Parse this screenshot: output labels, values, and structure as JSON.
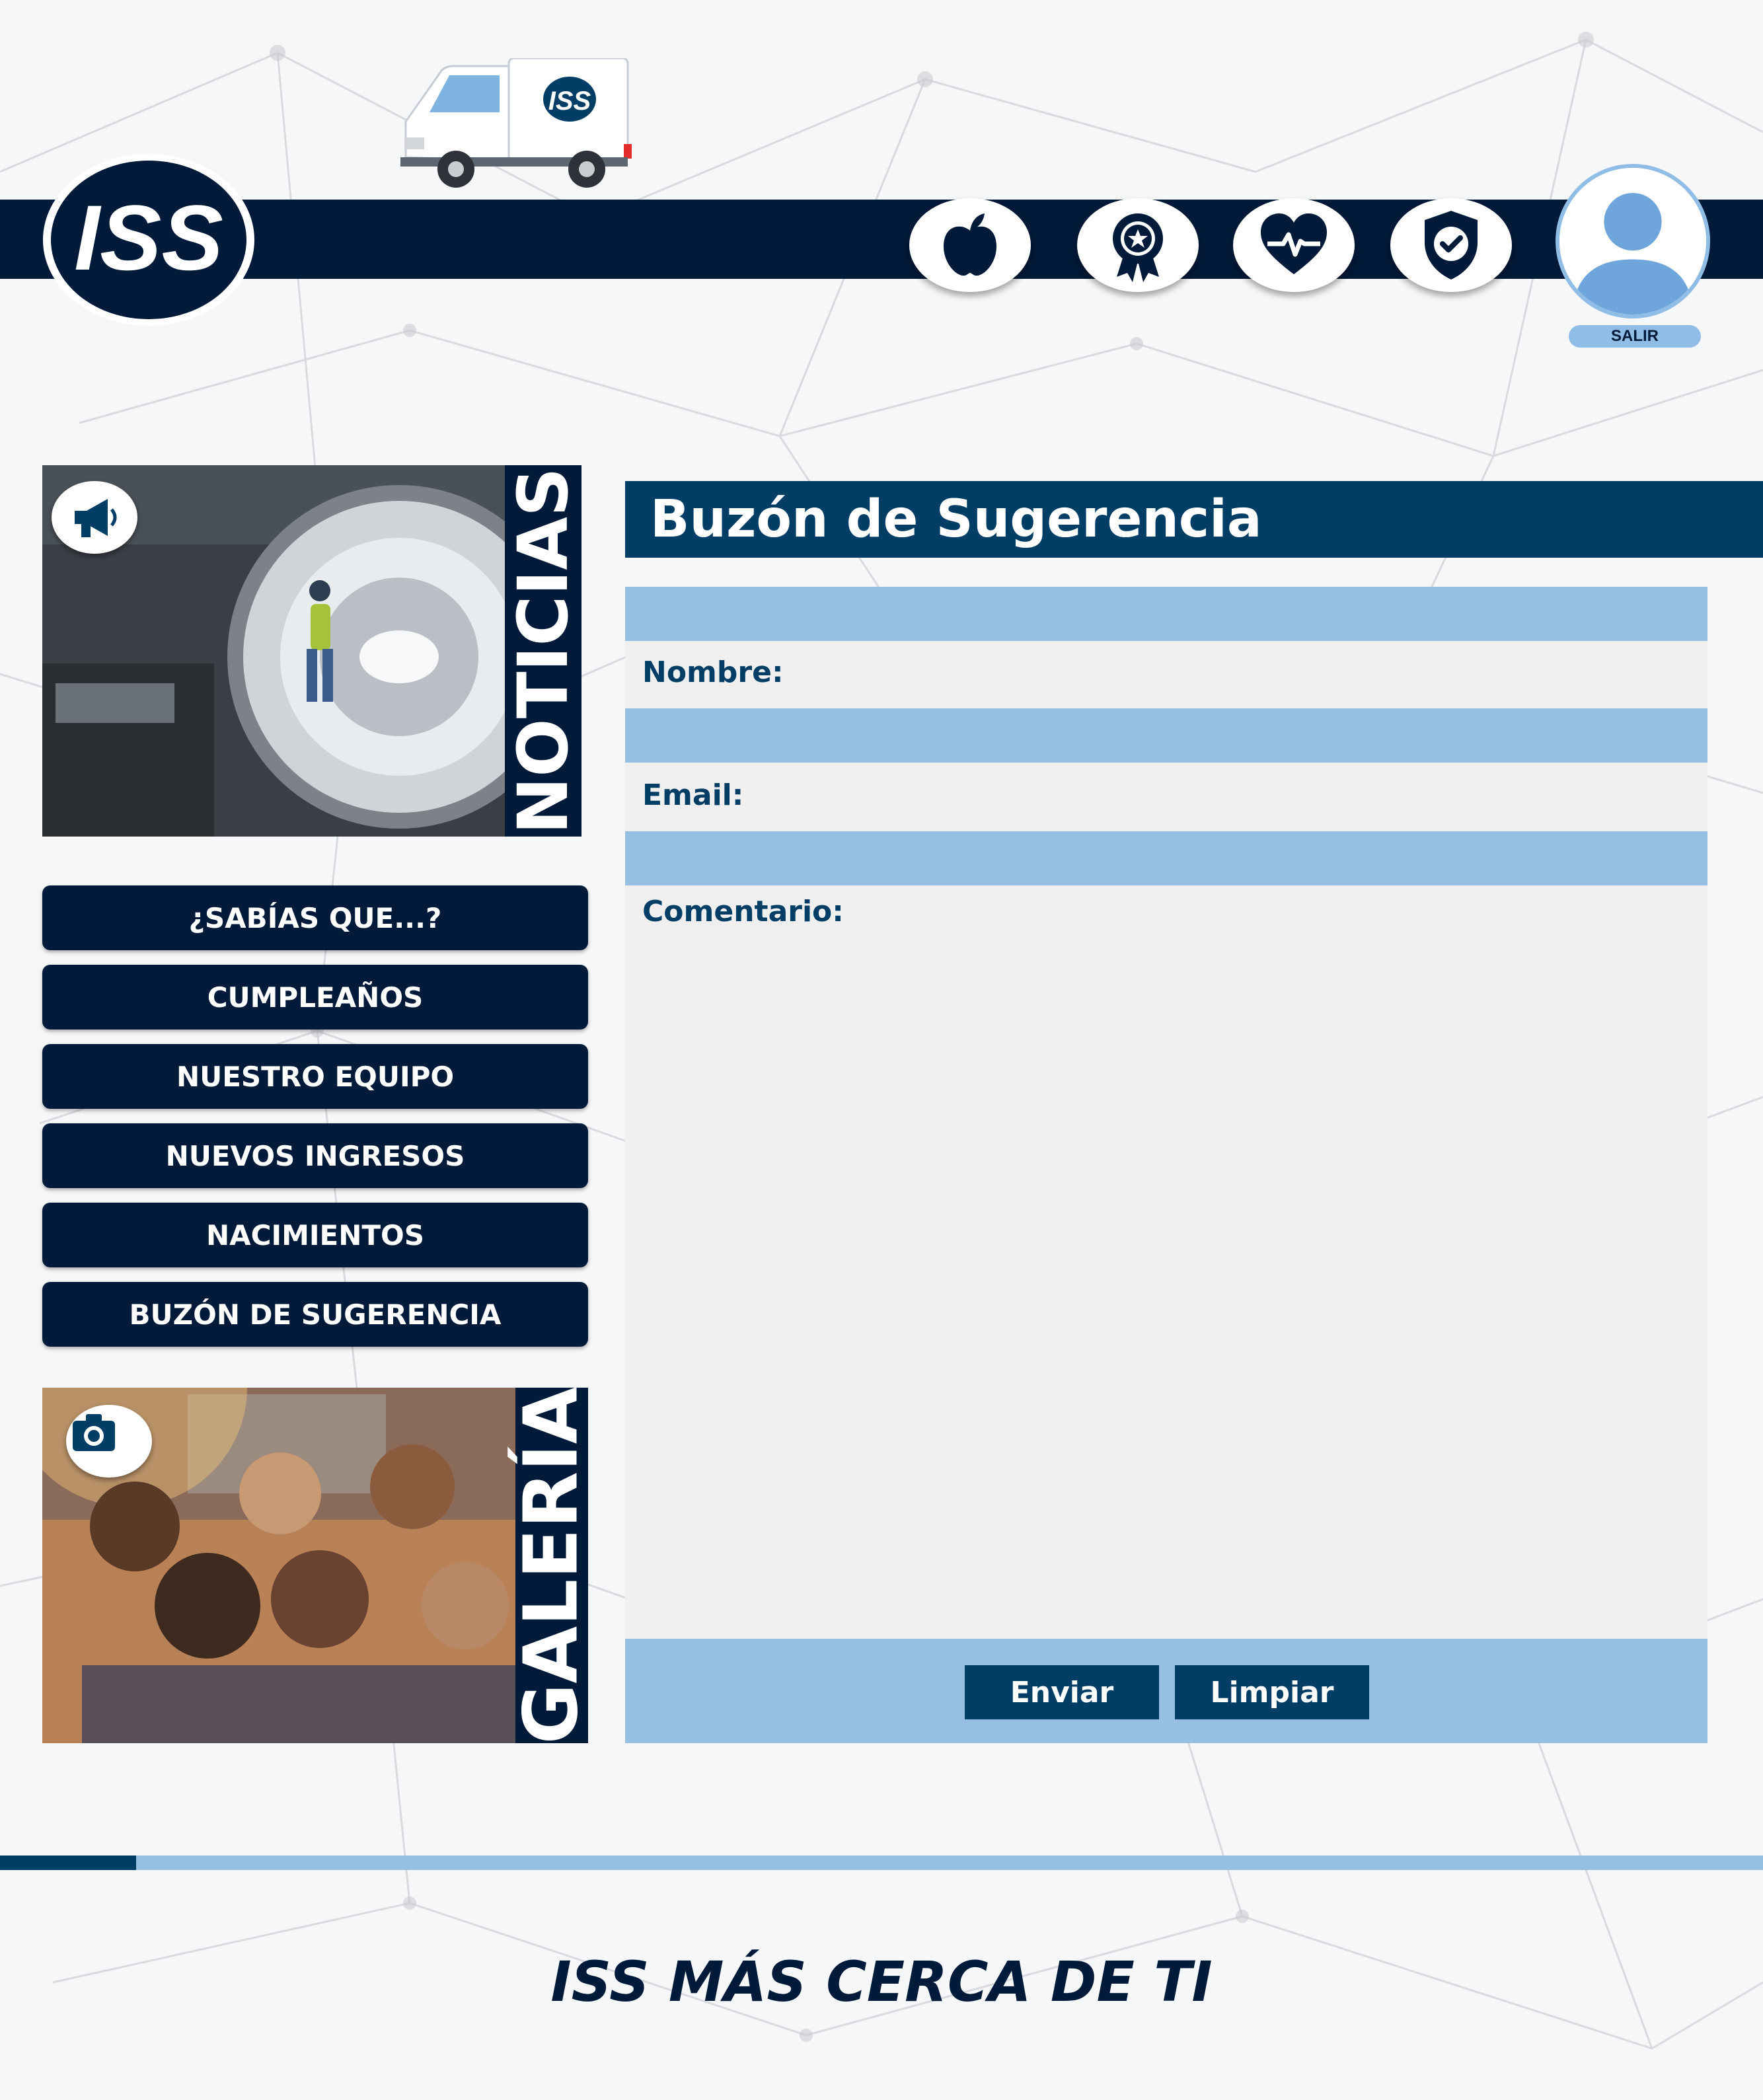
{
  "brand": {
    "logo_text": "ISS",
    "truck_logo_text": "ISS",
    "colors": {
      "navy": "#001a39",
      "blue": "#003e66",
      "light_blue": "#96bfe2",
      "panel": "#efefef"
    }
  },
  "header": {
    "icons": [
      "apple-icon",
      "award-badge-icon",
      "heart-pulse-icon",
      "shield-check-icon"
    ],
    "user_avatar": "user-silhouette-icon",
    "logout_label": "SALIR"
  },
  "sidebar": {
    "news": {
      "label": "NOTICIAS",
      "icon": "megaphone-icon"
    },
    "menu": [
      {
        "label": "¿SABÍAS QUE...?"
      },
      {
        "label": "CUMPLEAÑOS"
      },
      {
        "label": "NUESTRO EQUIPO"
      },
      {
        "label": "NUEVOS INGRESOS"
      },
      {
        "label": "NACIMIENTOS"
      },
      {
        "label": "BUZÓN DE SUGERENCIA"
      }
    ],
    "gallery": {
      "label": "GALERÍA",
      "icon": "camera-icon"
    }
  },
  "form": {
    "title": "Buzón de Sugerencia",
    "name_label": "Nombre:",
    "name_value": "",
    "email_label": "Email:",
    "email_value": "",
    "comment_label": "Comentario:",
    "comment_value": "",
    "submit_label": "Enviar",
    "clear_label": "Limpiar"
  },
  "footer": {
    "slogan": "ISS MÁS CERCA DE TI"
  }
}
